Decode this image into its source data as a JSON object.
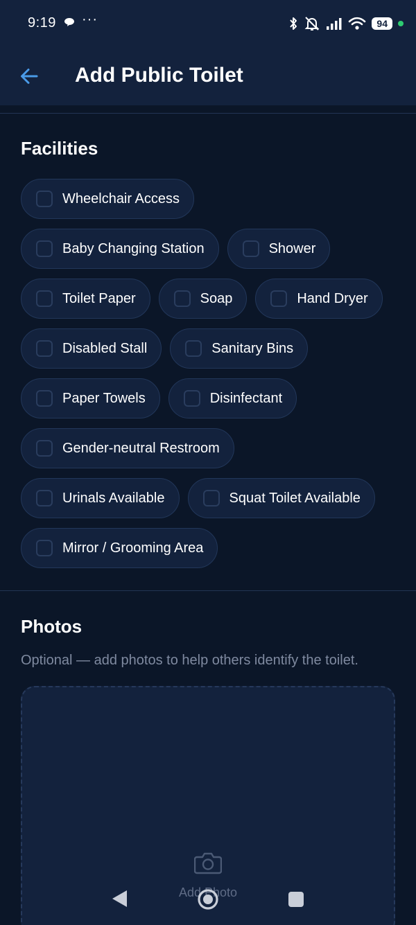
{
  "status_bar": {
    "time": "9:19",
    "more": "···",
    "battery": "94",
    "icons": [
      "chat-bubble-icon",
      "bluetooth-icon",
      "bell-off-icon",
      "signal-icon",
      "wifi-icon",
      "battery-icon"
    ]
  },
  "header": {
    "back_icon": "arrow-left-icon",
    "title": "Add Public Toilet"
  },
  "facilities": {
    "title": "Facilities",
    "rows": [
      [
        {
          "label": "Wheelchair Access",
          "checked": false
        }
      ],
      [
        {
          "label": "Baby Changing Station",
          "checked": false
        },
        {
          "label": "Shower",
          "checked": false
        }
      ],
      [
        {
          "label": "Toilet Paper",
          "checked": false
        },
        {
          "label": "Soap",
          "checked": false
        },
        {
          "label": "Hand Dryer",
          "checked": false
        }
      ],
      [
        {
          "label": "Disabled Stall",
          "checked": false
        },
        {
          "label": "Sanitary Bins",
          "checked": false
        }
      ],
      [
        {
          "label": "Paper Towels",
          "checked": false
        },
        {
          "label": "Disinfectant",
          "checked": false
        }
      ],
      [
        {
          "label": "Gender-neutral Restroom",
          "checked": false
        }
      ],
      [
        {
          "label": "Urinals Available",
          "checked": false
        },
        {
          "label": "Squat Toilet Available",
          "checked": false
        }
      ],
      [
        {
          "label": "Mirror / Grooming Area",
          "checked": false
        }
      ]
    ]
  },
  "photos": {
    "title": "Photos",
    "hint": "Optional — add photos to help others identify the toilet.",
    "add_label": "Add Photo",
    "icon": "camera-icon"
  },
  "nav": {
    "icons": [
      "nav-back-icon",
      "nav-home-icon",
      "nav-recents-icon"
    ]
  },
  "colors": {
    "background": "#0b1628",
    "surface": "#13223d",
    "border": "#22375a",
    "accent": "#4a9be8",
    "muted_text": "#7f8aa0"
  }
}
